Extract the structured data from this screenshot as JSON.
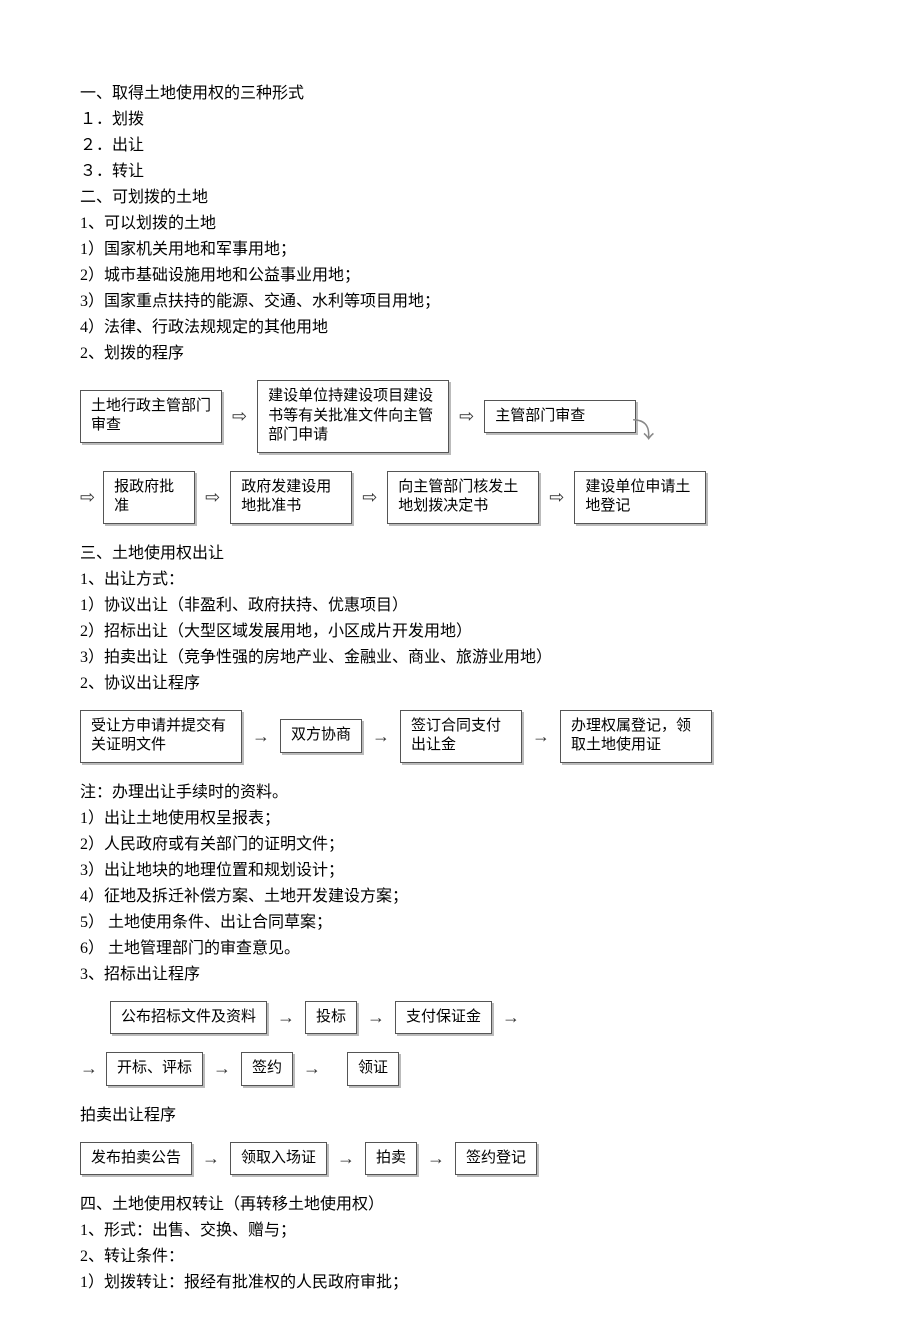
{
  "sec1": {
    "heading": "一、取得土地使用权的三种形式",
    "items": [
      "１．划拨",
      "２．出让",
      "３．转让"
    ]
  },
  "sec2": {
    "heading": "二、可划拨的土地",
    "sub1": "1、可以划拨的土地",
    "items": [
      "1）国家机关用地和军事用地；",
      "2）城市基础设施用地和公益事业用地；",
      "3）国家重点扶持的能源、交通、水利等项目用地；",
      "4）法律、行政法规规定的其他用地"
    ],
    "sub2": "2、划拨的程序",
    "flow_row1": [
      "土地行政主管部门审查",
      "建设单位持建设项目建设书等有关批准文件向主管部门申请",
      "主管部门审查"
    ],
    "flow_row2": [
      "报政府批准",
      "政府发建设用地批准书",
      "向主管部门核发土地划拨决定书",
      "建设单位申请土地登记"
    ]
  },
  "sec3": {
    "heading": "三、土地使用权出让",
    "sub1": "1、出让方式：",
    "methods": [
      "1）协议出让（非盈利、政府扶持、优惠项目）",
      "2）招标出让（大型区域发展用地，小区成片开发用地）",
      "3）拍卖出让（竞争性强的房地产业、金融业、商业、旅游业用地）"
    ],
    "sub2": "2、协议出让程序",
    "flow_agree": [
      "受让方申请并提交有关证明文件",
      "双方协商",
      "签订合同支付出让金",
      "办理权属登记，领取土地使用证"
    ],
    "note_head": "注：办理出让手续时的资料。",
    "notes": [
      "1）出让土地使用权呈报表；",
      "2）人民政府或有关部门的证明文件；",
      "3）出让地块的地理位置和规划设计；",
      "4）征地及拆迁补偿方案、土地开发建设方案；",
      "5） 土地使用条件、出让合同草案；",
      "6） 土地管理部门的审查意见。"
    ],
    "sub3": "3、招标出让程序",
    "flow_bid_row1": [
      "公布招标文件及资料",
      "投标",
      "支付保证金"
    ],
    "flow_bid_row2": [
      "开标、评标",
      "签约",
      "领证"
    ],
    "auction_head": "拍卖出让程序",
    "flow_auction": [
      "发布拍卖公告",
      "领取入场证",
      "拍卖",
      "签约登记"
    ]
  },
  "sec4": {
    "heading": "四、土地使用权转让（再转移土地使用权）",
    "l1": "1、形式：出售、交换、赠与；",
    "l2": "2、转让条件：",
    "l3": "1）划拨转让：报经有批准权的人民政府审批；"
  }
}
